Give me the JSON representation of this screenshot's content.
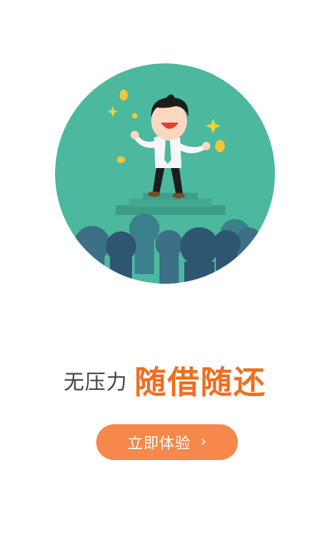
{
  "slogan": {
    "prefix": "无压力",
    "highlight": "随借随还"
  },
  "cta": {
    "label": "立即体验",
    "icon": "chevron-right-icon",
    "glyph": "›"
  },
  "colors": {
    "background": "#ffffff",
    "hero_circle": "#4cb89e",
    "accent": "#f26d1f",
    "button": "#f5884a",
    "text_dark": "#444444"
  },
  "hero": {
    "icon": "celebrating-man-illustration"
  }
}
